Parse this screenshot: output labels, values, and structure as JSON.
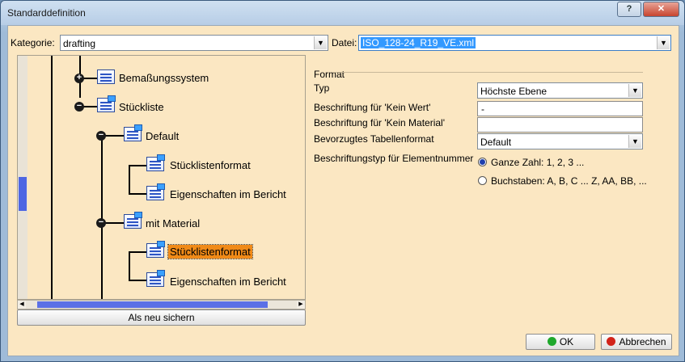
{
  "window": {
    "title": "Standarddefinition",
    "help_label": "?",
    "close_label": "✕"
  },
  "category": {
    "label": "Kategorie:",
    "value": "drafting"
  },
  "file": {
    "label": "Datei:",
    "value": "ISO_128-24_R19_VE.xml"
  },
  "tree": {
    "items": [
      {
        "label": "Bemaßungssystem"
      },
      {
        "label": "Stückliste"
      },
      {
        "label": "Default"
      },
      {
        "label": "Stücklistenformat"
      },
      {
        "label": "Eigenschaften im Bericht"
      },
      {
        "label": "mit Material"
      },
      {
        "label": "Stücklistenformat"
      },
      {
        "label": "Eigenschaften im Bericht"
      }
    ],
    "selected_index": 6
  },
  "save_as_new": "Als neu sichern",
  "format": {
    "group_label": "Format",
    "type": {
      "label": "Typ",
      "value": "Höchste Ebene"
    },
    "no_value": {
      "label": "Beschriftung für 'Kein Wert'",
      "value": "-"
    },
    "no_material": {
      "label": "Beschriftung für 'Kein Material'",
      "value": ""
    },
    "table_format": {
      "label": "Bevorzugtes Tabellenformat",
      "value": "Default"
    },
    "numbering": {
      "label": "Beschriftungstyp für Elementnummer",
      "options": [
        {
          "label": "Ganze Zahl: 1, 2, 3 ...",
          "selected": true
        },
        {
          "label": "Buchstaben: A, B, C ... Z, AA, BB, ...",
          "selected": false
        }
      ]
    }
  },
  "buttons": {
    "ok": "OK",
    "cancel": "Abbrechen"
  },
  "colors": {
    "client_bg": "#fbe7c2",
    "selection": "#f08a18",
    "ok_dot": "#1fa82c",
    "cancel_dot": "#d2231a"
  }
}
